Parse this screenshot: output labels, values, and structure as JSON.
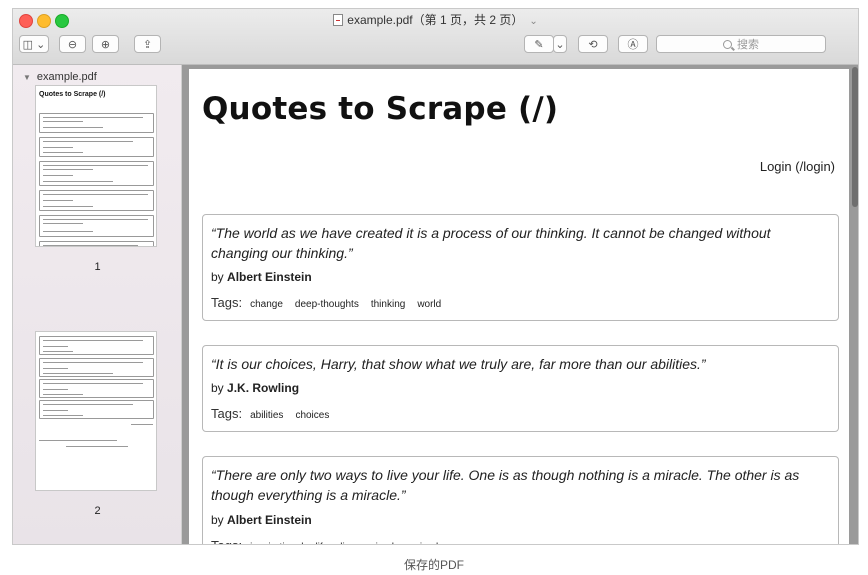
{
  "window": {
    "title": "example.pdf（第 1 页，共 2 页）",
    "title_chevron": "⌄"
  },
  "toolbar": {
    "sidebar_toggle": "◫ ⌄",
    "zoom_out": "⊖",
    "zoom_in": "⊕",
    "share": "⇪",
    "markup": "✎",
    "markup_menu": "⌄",
    "rotate": "⟲",
    "annotate": "Ⓐ",
    "search_placeholder": "搜索"
  },
  "sidebar": {
    "file_name": "example.pdf",
    "pages": [
      {
        "number": "1"
      },
      {
        "number": "2"
      }
    ],
    "thumb1_title": "Quotes to Scrape (/)"
  },
  "page": {
    "heading": "Quotes to Scrape (/)",
    "login": "Login (/login)",
    "by_prefix": "by",
    "tags_label": "Tags:",
    "quotes": [
      {
        "text": "“The world as we have created it is a process of our thinking. It cannot be changed without changing our thinking.”",
        "author": "Albert Einstein",
        "tags": [
          "change",
          "deep-thoughts",
          "thinking",
          "world"
        ]
      },
      {
        "text": "“It is our choices, Harry, that show what we truly are, far more than our abilities.”",
        "author": "J.K. Rowling",
        "tags": [
          "abilities",
          "choices"
        ]
      },
      {
        "text": "“There are only two ways to live your life. One is as though nothing is a miracle. The other is as though everything is a miracle.”",
        "author": "Albert Einstein",
        "tags": [
          "inspirational",
          "life",
          "live",
          "miracle",
          "miracles"
        ]
      }
    ]
  },
  "caption": "保存的PDF",
  "colors": {
    "close": "#fe5f57",
    "minimize": "#febc2e",
    "zoom": "#28c840"
  }
}
